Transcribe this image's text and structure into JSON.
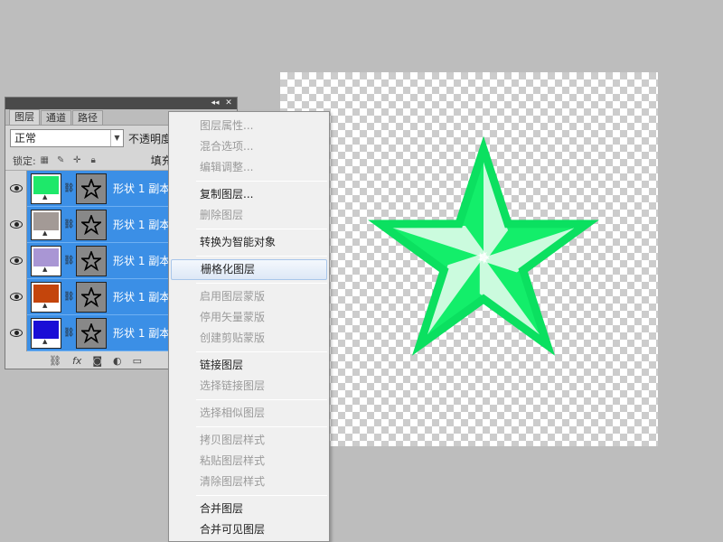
{
  "panel": {
    "tabs": [
      "图层",
      "通道",
      "路径"
    ],
    "blend_mode": "正常",
    "opacity_label": "不透明度",
    "lock_label": "锁定:",
    "fill_label": "填充",
    "layers": [
      {
        "name": "形状 1 副本",
        "color": "#1ee86a"
      },
      {
        "name": "形状 1 副本",
        "color": "#a39a96"
      },
      {
        "name": "形状 1 副本",
        "color": "#a996d4"
      },
      {
        "name": "形状 1 副本",
        "color": "#c4450c"
      },
      {
        "name": "形状 1 副本",
        "color": "#1a0dd6"
      }
    ],
    "bottom_icons": [
      "link-icon",
      "fx-icon",
      "mask-icon",
      "adjustment-icon",
      "folder-icon"
    ]
  },
  "menu": {
    "groups": [
      [
        {
          "label": "图层属性...",
          "enabled": false
        },
        {
          "label": "混合选项...",
          "enabled": false
        },
        {
          "label": "编辑调整...",
          "enabled": false
        }
      ],
      [
        {
          "label": "复制图层...",
          "enabled": true
        },
        {
          "label": "删除图层",
          "enabled": false
        }
      ],
      [
        {
          "label": "转换为智能对象",
          "enabled": true
        }
      ],
      [
        {
          "label": "栅格化图层",
          "enabled": true,
          "highlight": true
        }
      ],
      [
        {
          "label": "启用图层蒙版",
          "enabled": false
        },
        {
          "label": "停用矢量蒙版",
          "enabled": false
        },
        {
          "label": "创建剪贴蒙版",
          "enabled": false
        }
      ],
      [
        {
          "label": "链接图层",
          "enabled": true
        },
        {
          "label": "选择链接图层",
          "enabled": false
        }
      ],
      [
        {
          "label": "选择相似图层",
          "enabled": false
        }
      ],
      [
        {
          "label": "拷贝图层样式",
          "enabled": false
        },
        {
          "label": "粘贴图层样式",
          "enabled": false
        },
        {
          "label": "清除图层样式",
          "enabled": false
        }
      ],
      [
        {
          "label": "合并图层",
          "enabled": true
        },
        {
          "label": "合并可见图层",
          "enabled": true
        }
      ]
    ]
  },
  "canvas": {
    "star_color": "#13ee6a",
    "star_edge": "#0be060"
  }
}
